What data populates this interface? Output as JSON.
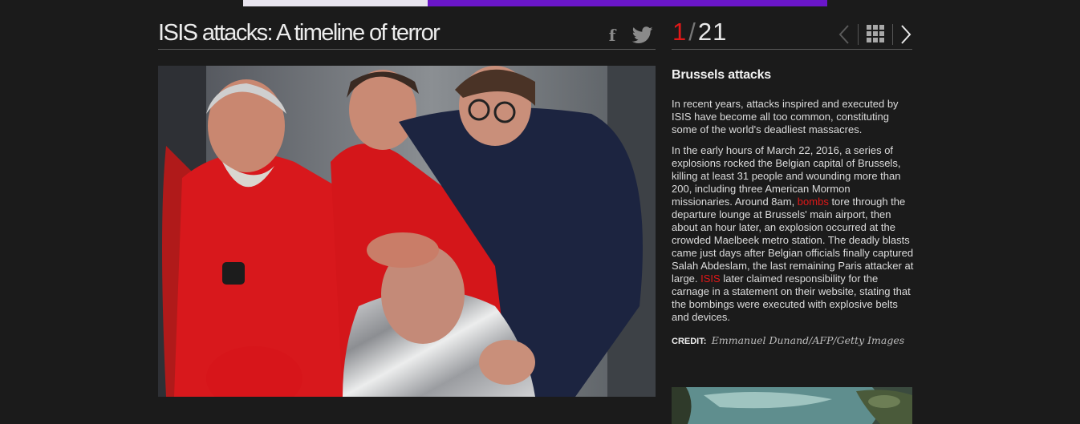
{
  "header": {
    "title": "ISIS attacks: A timeline of terror",
    "share_facebook_glyph": "f",
    "share_facebook_icon": "facebook-icon",
    "share_twitter_icon": "twitter-icon"
  },
  "gallery": {
    "current": "1",
    "separator": "/",
    "total": "21",
    "prev_icon": "chevron-left-icon",
    "grid_icon": "grid-icon",
    "next_icon": "chevron-right-icon"
  },
  "slide": {
    "title": "Brussels attacks",
    "para1": "In recent years, attacks inspired and executed by ISIS have become all too common, constituting some of the world's deadliest massacres.",
    "para2_a": "In the early hours of March 22, 2016, a series of explosions rocked the Belgian capital of Brussels, killing at least 31 people and wounding more than 200, including three American Mormon missionaries. Around 8am, ",
    "link_bombs": "bombs",
    "para2_b": " tore through the departure lounge at Brussels' main airport, then about an hour later, an explosion occurred at the crowded Maelbeek metro station. The deadly blasts came just days after Belgian officials finally captured Salah Abdeslam, the last remaining Paris attacker at large. ",
    "link_isis": "ISIS",
    "para2_c": " later claimed responsibility for the carnage in a statement on their website, stating that the bombings were executed with explosive belts and devices.",
    "credit_label": "CREDIT:",
    "credit_name": "Emmanuel Dunand/AFP/Getty Images"
  },
  "colors": {
    "background": "#1b1b1b",
    "accent_red": "#e01818",
    "ad_purple": "#6a16c9"
  }
}
